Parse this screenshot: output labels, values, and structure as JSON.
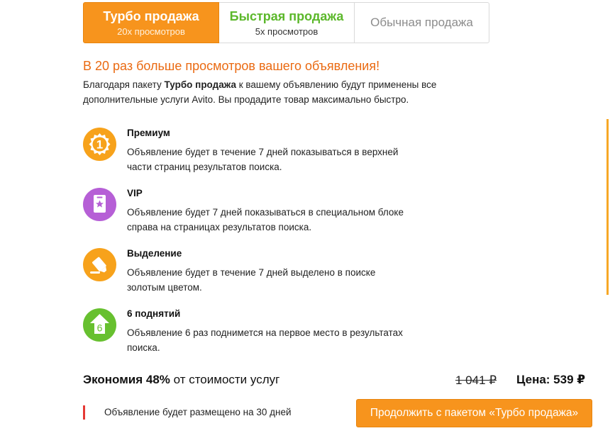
{
  "tabs": [
    {
      "title": "Турбо продажа",
      "subtitle": "20х просмотров"
    },
    {
      "title": "Быстрая продажа",
      "subtitle": "5х просмотров"
    },
    {
      "title": "Обычная продажа"
    }
  ],
  "headline": "В 20 раз больше просмотров вашего объявления!",
  "description": {
    "prefix": "Благодаря пакету ",
    "bold": "Турбо продажа",
    "suffix": " к вашему объявлению будут применены все дополнительные услуги Avito. Вы продадите товар максимально быстро."
  },
  "features": [
    {
      "title": "Премиум",
      "text": "Объявление будет в течение 7 дней показываться в верхней части страниц результатов поиска.",
      "icon": "premium-badge-icon",
      "icon_label": "1",
      "color": "#f7a21b"
    },
    {
      "title": "VIP",
      "text": "Объявление будет 7 дней показываться в специальном блоке справа на страницах результатов поиска.",
      "icon": "vip-star-card-icon",
      "color": "#b65fd6"
    },
    {
      "title": "Выделение",
      "text": "Объявление будет в течение 7 дней выделено в поиске золотым цветом.",
      "icon": "highlight-marker-icon",
      "color": "#f7a21b"
    },
    {
      "title": "6 поднятий",
      "text": "Объявление 6 раз поднимется на первое место в результатах поиска.",
      "icon": "raise-arrow-icon",
      "icon_label": "6",
      "color": "#67c02f"
    }
  ],
  "savings": {
    "bold": "Экономия 48%",
    "rest": " от стоимости услуг"
  },
  "old_price": "1 041 ₽",
  "new_price": "Цена: 539 ₽",
  "note": "Объявление будет размещено на 30 дней",
  "cta_label": "Продолжить с пакетом «Турбо продажа»",
  "colors": {
    "accent": "#f7941d",
    "headline": "#ea6a12",
    "fast": "#5cb82b",
    "note_marker": "#e53935"
  }
}
